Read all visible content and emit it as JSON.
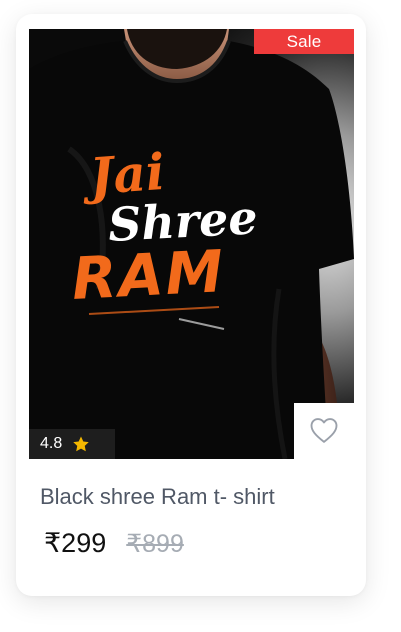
{
  "product": {
    "badge": "Sale",
    "rating": "4.8",
    "title": "Black shree Ram t- shirt",
    "price": "₹299",
    "original_price": "₹899"
  },
  "print": {
    "line1": "Jai",
    "line2": "Shree",
    "line3": "RAM"
  },
  "icons": {
    "rating": "star-icon",
    "wishlist": "heart-outline-icon"
  },
  "colors": {
    "sale": "#ee3b3b",
    "star": "#f5b800",
    "print_orange": "#f26a1b"
  }
}
